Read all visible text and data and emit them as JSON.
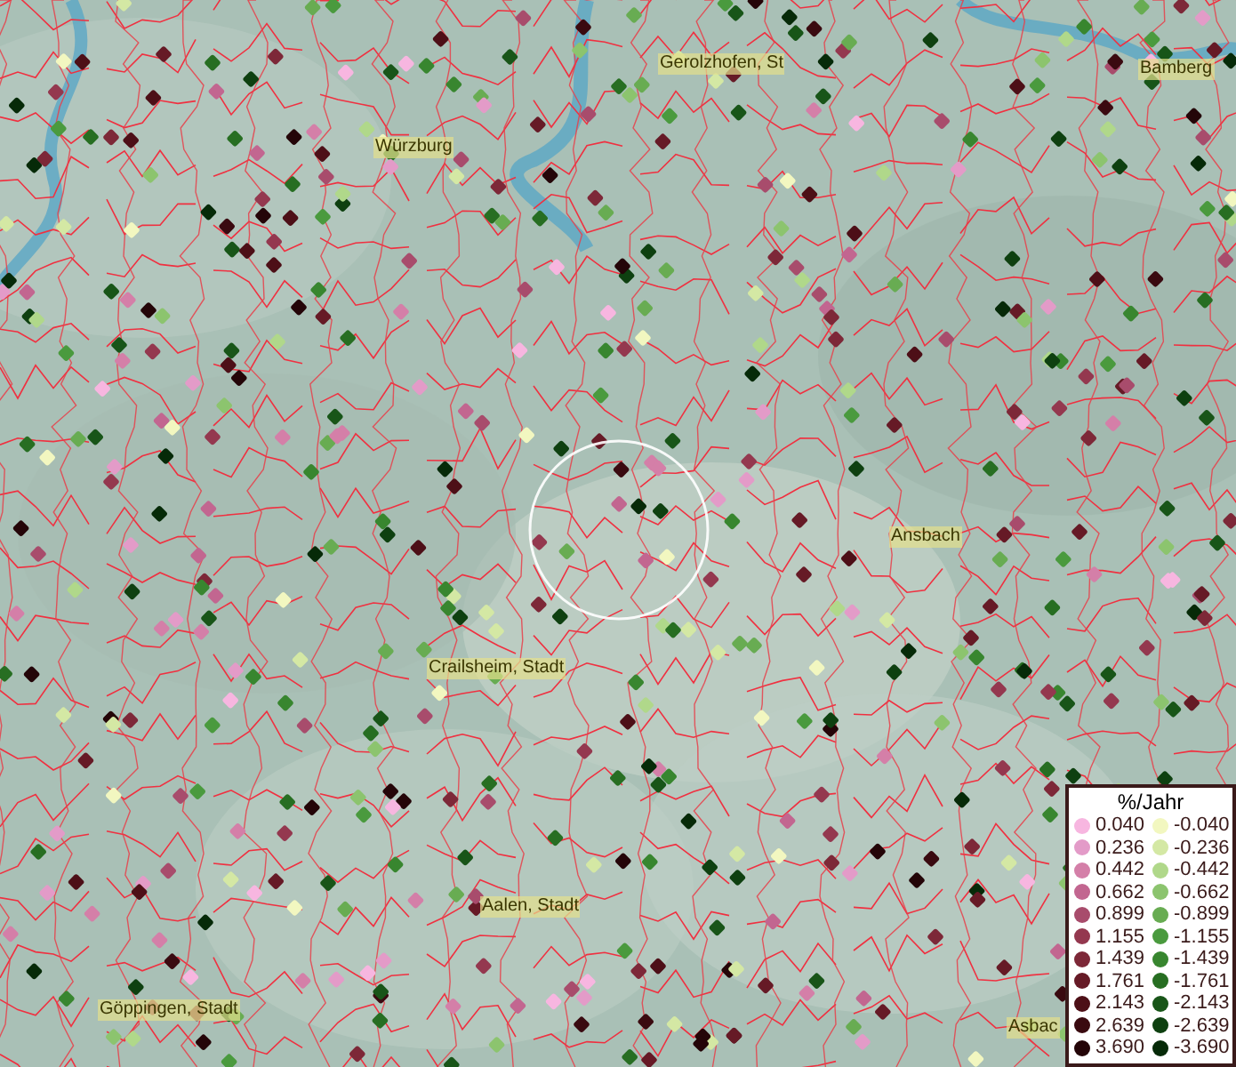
{
  "map": {
    "places": [
      {
        "name": "Gerolzhofen, St"
      },
      {
        "name": "Bamberg"
      },
      {
        "name": "Würzburg"
      },
      {
        "name": "Ansbach"
      },
      {
        "name": "Crailsheim, Stadt"
      },
      {
        "name": "Aalen, Stadt"
      },
      {
        "name": "Göppingen, Stadt"
      },
      {
        "name": "Asbac"
      }
    ]
  },
  "legend": {
    "title": "%/Jahr",
    "entries": [
      {
        "label": "0.040",
        "color": "#f7b6e0"
      },
      {
        "label": "-0.040",
        "color": "#f2f7c0"
      },
      {
        "label": "0.236",
        "color": "#e39bc8"
      },
      {
        "label": "-0.236",
        "color": "#d4e8a4"
      },
      {
        "label": "0.442",
        "color": "#d47fa8"
      },
      {
        "label": "-0.442",
        "color": "#b0d88a"
      },
      {
        "label": "0.662",
        "color": "#c26690"
      },
      {
        "label": "-0.662",
        "color": "#8cc46e"
      },
      {
        "label": "0.899",
        "color": "#a84c6c"
      },
      {
        "label": "-0.899",
        "color": "#68ac52"
      },
      {
        "label": "1.155",
        "color": "#94384f"
      },
      {
        "label": "-1.155",
        "color": "#4a9a3e"
      },
      {
        "label": "1.439",
        "color": "#7d2838"
      },
      {
        "label": "-1.439",
        "color": "#38862f"
      },
      {
        "label": "1.761",
        "color": "#661a26"
      },
      {
        "label": "-1.761",
        "color": "#276e22"
      },
      {
        "label": "2.143",
        "color": "#4d0f17"
      },
      {
        "label": "-2.143",
        "color": "#185518"
      },
      {
        "label": "2.639",
        "color": "#3a0a10"
      },
      {
        "label": "-2.639",
        "color": "#0e4010"
      },
      {
        "label": "3.690",
        "color": "#240508"
      },
      {
        "label": "-3.690",
        "color": "#062a08"
      }
    ]
  }
}
